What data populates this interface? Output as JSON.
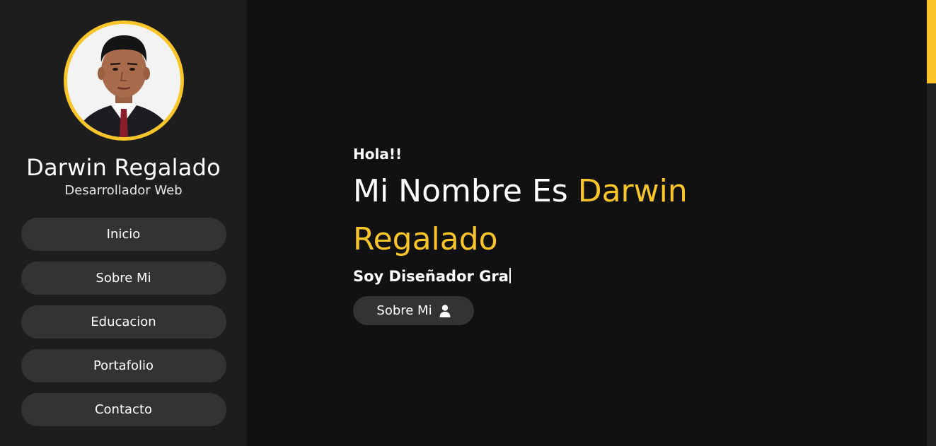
{
  "profile": {
    "name": "Darwin Regalado",
    "role": "Desarrollador Web",
    "photo_icon": "avatar-photo"
  },
  "nav": {
    "items": [
      {
        "label": "Inicio"
      },
      {
        "label": "Sobre Mi"
      },
      {
        "label": "Educacion"
      },
      {
        "label": "Portafolio"
      },
      {
        "label": "Contacto"
      }
    ]
  },
  "hero": {
    "greeting": "Hola!!",
    "headline_prefix": "Mi Nombre Es ",
    "headline_highlight": "Darwin Regalado",
    "typed_text": "Soy Diseñador Gra",
    "button_label": "Sobre Mi",
    "button_icon": "user-icon"
  },
  "theme": {
    "accent": "#f9c529",
    "sidebar_bg": "#1d1d1d",
    "main_bg": "#111111",
    "button_bg": "#333333"
  },
  "scrollbar": {
    "position": 0
  }
}
